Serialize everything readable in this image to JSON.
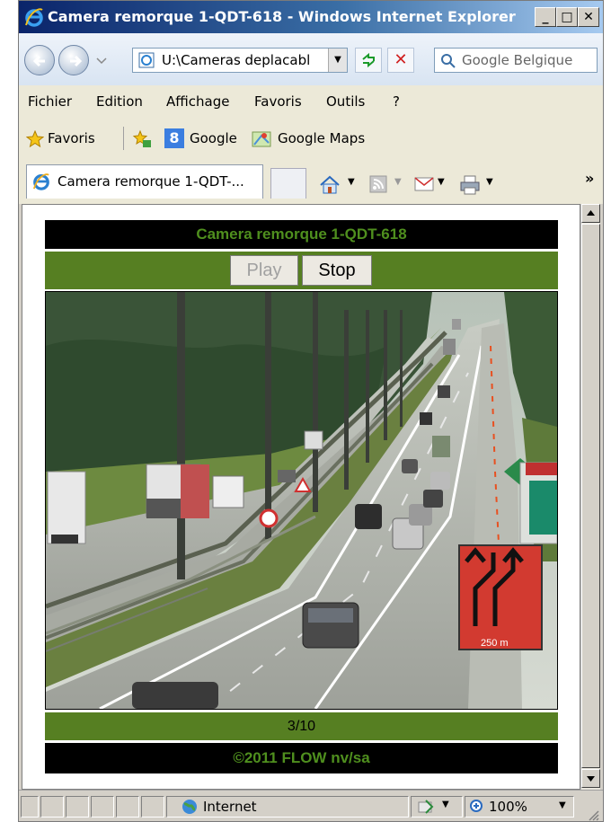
{
  "window": {
    "title": "Camera remorque 1-QDT-618 - Windows Internet Explorer",
    "min": "_",
    "max": "□",
    "close": "✕"
  },
  "navbar": {
    "address": "U:\\Cameras deplacabl",
    "search_placeholder": "Google Belgique"
  },
  "menu": {
    "items": [
      "Fichier",
      "Edition",
      "Affichage",
      "Favoris",
      "Outils",
      "?"
    ]
  },
  "favbar": {
    "favorites": "Favoris",
    "links": [
      "Google",
      "Google Maps"
    ]
  },
  "tabs": {
    "active_label": "Camera remorque 1-QDT-...",
    "overflow": "»"
  },
  "page": {
    "camera_title": "Camera remorque 1-QDT-618",
    "play_label": "Play",
    "stop_label": "Stop",
    "counter": "3/10",
    "footer": "©2011 FLOW nv/sa",
    "sign_text": "250 m"
  },
  "statusbar": {
    "zone": "Internet",
    "zoom": "100%"
  },
  "colors": {
    "bar_green": "#567f22",
    "title_green": "#4f8f1e",
    "title_bg": "#000000"
  }
}
